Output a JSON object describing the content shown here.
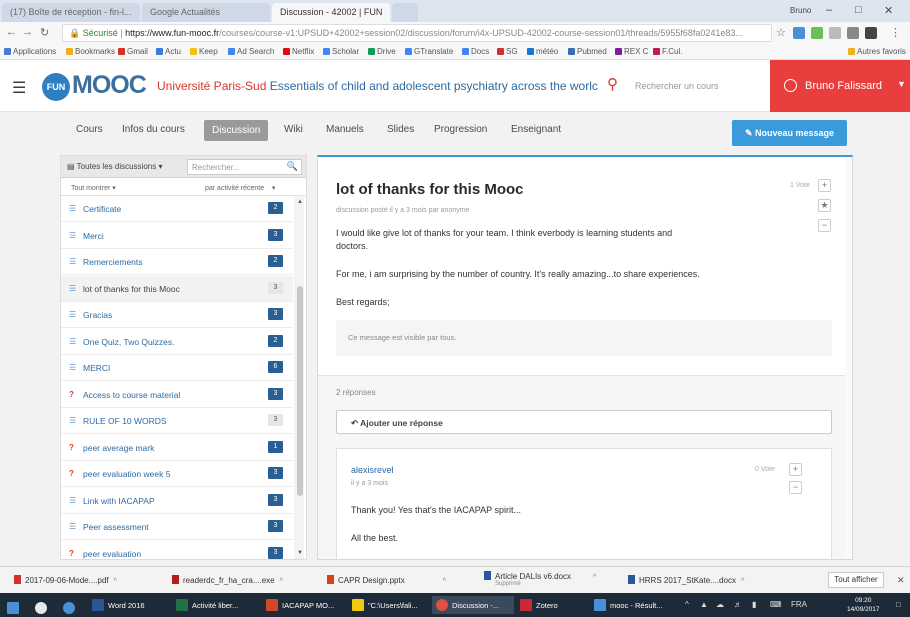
{
  "browser": {
    "tabs": [
      {
        "label": "(17) Boîte de réception - fin-l..."
      },
      {
        "label": "Google Actualités"
      },
      {
        "label": "Discussion - 42002 | FUN"
      }
    ],
    "window_controls": [
      "Bruno",
      "–",
      "□",
      "✕"
    ],
    "url": {
      "secure_label": "Sécurisé",
      "host": "https://www.fun-mooc.fr",
      "path": "/courses/course-v1:UPSUD+42002+session02/discussion/forum/i4x-UPSUD-42002-course-session01/threads/5955f68fa0241e83..."
    },
    "bookmarks": [
      {
        "label": "Applications",
        "color": "#4a7bd4"
      },
      {
        "label": "Bookmarks",
        "color": "#f2b01e"
      },
      {
        "label": "Gmail",
        "color": "#d93025"
      },
      {
        "label": "Actu",
        "color": "#3b7ddd"
      },
      {
        "label": "Keep",
        "color": "#f4c20d"
      },
      {
        "label": "Ad Search",
        "color": "#4285f4"
      },
      {
        "label": "Netflix",
        "color": "#e50914"
      },
      {
        "label": "Scholar",
        "color": "#4285f4"
      },
      {
        "label": "Drive",
        "color": "#0f9d58"
      },
      {
        "label": "GTranslate",
        "color": "#4285f4"
      },
      {
        "label": "Docs",
        "color": "#4285f4"
      },
      {
        "label": "SG",
        "color": "#d32f2f"
      },
      {
        "label": "météo",
        "color": "#1976d2"
      },
      {
        "label": "Pubmed",
        "color": "#3a6fb0"
      },
      {
        "label": "REX C",
        "color": "#7b1fa2"
      },
      {
        "label": "F.Cul.",
        "color": "#c2185b"
      },
      {
        "label": "Autres favoris",
        "color": "#f2b01e"
      }
    ]
  },
  "site": {
    "logo_badge": "FUN",
    "logo_text": "MOOC",
    "university": "Université Paris-Sud",
    "course_name": "Essentials of child and adolescent psychiatry across the worlc",
    "search_placeholder": "Rechercher un cours",
    "user_name": "Bruno Falissard",
    "accent_red": "#e83e3e",
    "accent_blue": "#3b9ad9"
  },
  "course_nav": {
    "items": [
      "Cours",
      "Infos du cours",
      "Discussion",
      "Wiki",
      "Manuels",
      "Slides",
      "Progression",
      "Enseignant"
    ],
    "active": "Discussion",
    "new_message": "Nouveau message"
  },
  "sidebar": {
    "all_discussions": "Toutes les discussions",
    "search_placeholder": "Rechercher...",
    "filter_show": "Tout montrer",
    "filter_sort": "par activité récente",
    "threads": [
      {
        "title": "Certificate",
        "count": "2",
        "icon": "discussion",
        "read": false
      },
      {
        "title": "Merci",
        "count": "3",
        "icon": "discussion",
        "read": false
      },
      {
        "title": "Remerciements",
        "count": "2",
        "icon": "discussion",
        "read": false
      },
      {
        "title": "lot of thanks for this Mooc",
        "count": "3",
        "icon": "discussion",
        "read": true,
        "selected": true
      },
      {
        "title": "Gracias",
        "count": "3",
        "icon": "discussion",
        "read": false
      },
      {
        "title": "One Quiz, Two Quizzes.",
        "count": "2",
        "icon": "discussion",
        "read": false
      },
      {
        "title": "MERCI",
        "count": "6",
        "icon": "discussion",
        "read": false
      },
      {
        "title": "Access to course material",
        "count": "3",
        "icon": "question",
        "read": false
      },
      {
        "title": "RULE OF 10 WORDS",
        "count": "3",
        "icon": "discussion",
        "read": true
      },
      {
        "title": "peer average mark",
        "count": "1",
        "icon": "question",
        "read": false
      },
      {
        "title": "peer evaluation week 5",
        "count": "3",
        "icon": "question",
        "read": false
      },
      {
        "title": "Link with IACAPAP",
        "count": "3",
        "icon": "discussion",
        "read": false
      },
      {
        "title": "Peer assessment",
        "count": "3",
        "icon": "discussion",
        "read": false
      },
      {
        "title": "peer evaluation",
        "count": "3",
        "icon": "question",
        "read": false
      }
    ]
  },
  "post": {
    "title": "lot of thanks for this Mooc",
    "meta": "discussion posté il y a 3 mois par anonyme",
    "votes": "1 Vote",
    "body": [
      "I would like give lot of thanks for your team. I think everbody is learning students and",
      "doctors.",
      "For me, i am surprising by the number of country. It's really amazing...to share experiences.",
      "Best regards;"
    ],
    "visibility_note": "Ce message est visible par tous.",
    "responses_count": "2 réponses",
    "add_reply": "Ajouter une réponse"
  },
  "reply": {
    "author": "alexisrevel",
    "time": "il y a 3 mois",
    "votes": "0 Vote",
    "body": [
      "Thank you! Yes that's the IACAPAP spirit...",
      "All the best."
    ]
  },
  "downloads": {
    "items": [
      {
        "name": "2017-09-06-Mode....pdf",
        "sub": "",
        "color": "#d32f2f"
      },
      {
        "name": "readerdc_fr_ha_cra....exe",
        "sub": "",
        "color": "#b71c1c"
      },
      {
        "name": "CAPR Design.pptx",
        "sub": "",
        "color": "#d84315"
      },
      {
        "name": "Article DALIs v6.docx",
        "sub": "Supprimé",
        "color": "#2b5797"
      },
      {
        "name": "HRRS 2017_StKate....docx",
        "sub": "",
        "color": "#2b5797"
      }
    ],
    "show_all": "Tout afficher"
  },
  "taskbar": {
    "apps": [
      {
        "label": "",
        "color": "#4a90d9"
      },
      {
        "label": "",
        "color": "#e8e8e8"
      },
      {
        "label": "Word 2016",
        "color": "#2b5797"
      },
      {
        "label": "Activité liber...",
        "color": "#217346"
      },
      {
        "label": "IACAPAP MO...",
        "color": "#d24726"
      },
      {
        "label": "\"C:\\Users\\fali...",
        "color": "#f2c811"
      },
      {
        "label": "Discussion -...",
        "color": "#dd5144"
      },
      {
        "label": "Zotero",
        "color": "#cc2936"
      },
      {
        "label": "mooc - Résult...",
        "color": "#4a90d9"
      }
    ],
    "lang": "FRA",
    "time": "09:20",
    "date": "14/09/2017"
  }
}
